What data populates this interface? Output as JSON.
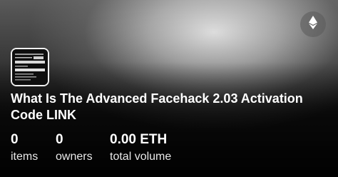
{
  "collection": {
    "title": "What Is The Advanced Facehack 2.03 Activation Code LINK"
  },
  "network_icon": "ethereum-icon",
  "stats": [
    {
      "value": "0",
      "label": "items"
    },
    {
      "value": "0",
      "label": "owners"
    },
    {
      "value": "0.00 ETH",
      "label": "total volume"
    }
  ]
}
